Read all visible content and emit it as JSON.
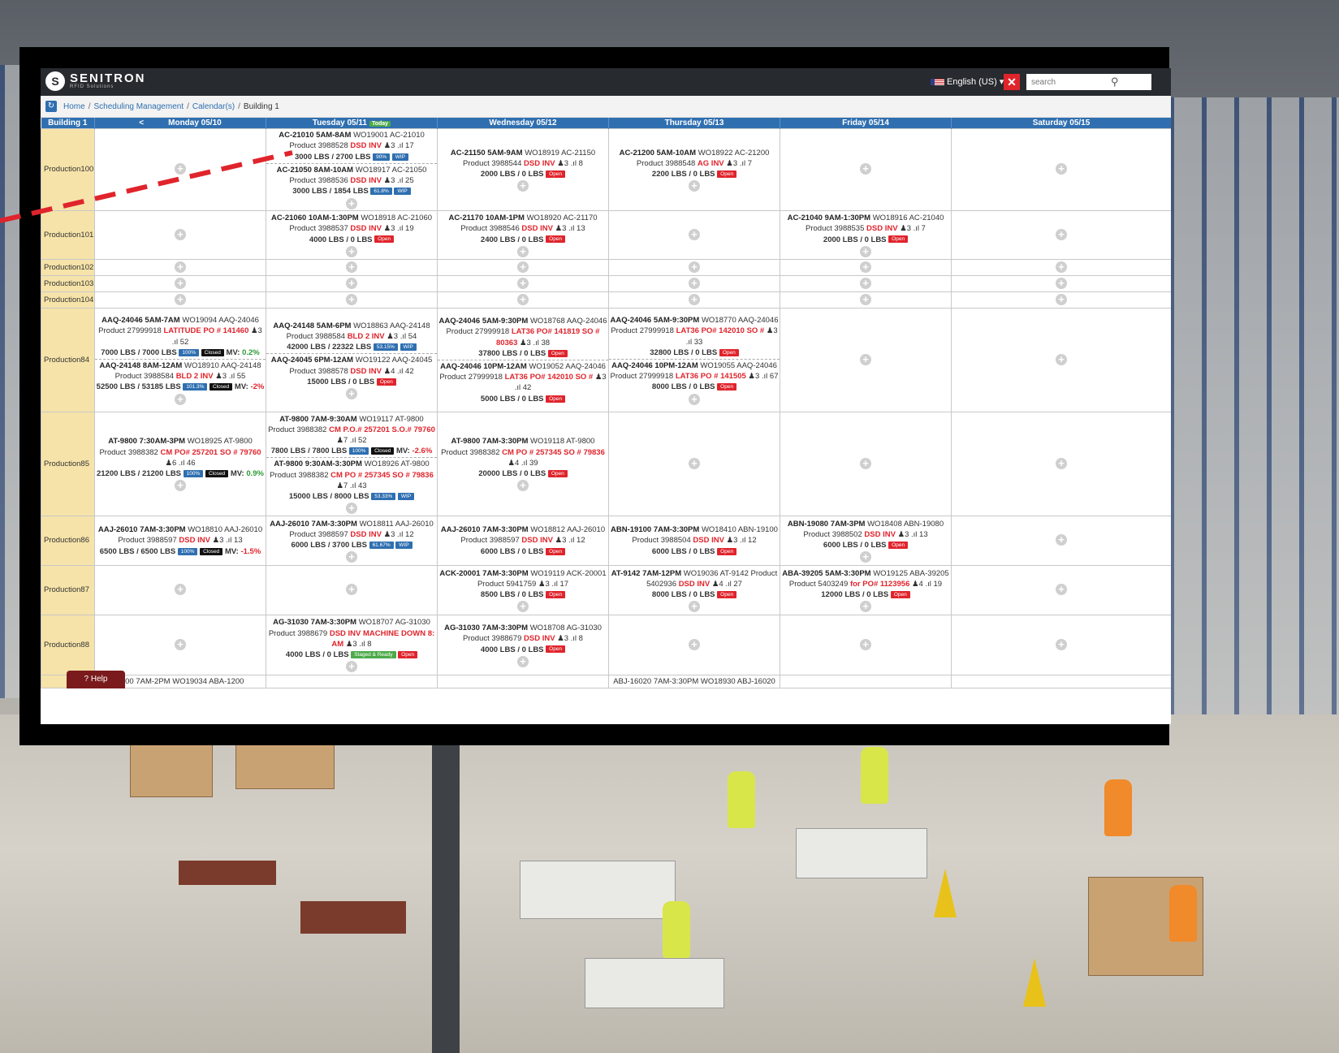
{
  "app": {
    "brand": "SENITRON",
    "brand_sub": "RFID Solutions",
    "language": "English (US)",
    "search_placeholder": "search"
  },
  "breadcrumb": [
    "Home",
    "Scheduling Management",
    "Calendar(s)",
    "Building 1"
  ],
  "header": {
    "building": "Building 1",
    "prev": "<",
    "days": [
      "Monday 05/10",
      "Tuesday 05/11",
      "Wednesday 05/12",
      "Thursday 05/13",
      "Friday 05/14",
      "Saturday 05/15"
    ],
    "today_badge": "Today"
  },
  "rows": {
    "r100": "Production100",
    "r101": "Production101",
    "r102": "Production102",
    "r103": "Production103",
    "r104": "Production104",
    "r84": "Production84",
    "r85": "Production85",
    "r86": "Production86",
    "r87": "Production87",
    "r88": "Production88"
  },
  "jobs": {
    "r100_tue_1": {
      "line1": "AC-21010 5AM-8AM",
      "line1b": "WO19001 AC-21010",
      "prod": "Product 3988528",
      "tag": "DSD INV",
      "meta": "3 .ıl 17",
      "lbs": "3000 LBS / 2700 LBS",
      "b1": "90%",
      "b2": "WIP"
    },
    "r100_tue_2": {
      "line1": "AC-21050 8AM-10AM",
      "line1b": "WO18917 AC-21050",
      "prod": "Product 3988536",
      "tag": "DSD INV",
      "meta": "3 .ıl 25",
      "lbs": "3000 LBS / 1854 LBS",
      "b1": "61.8%",
      "b2": "WIP"
    },
    "r100_wed": {
      "line1": "AC-21150 5AM-9AM",
      "line1b": "WO18919 AC-21150",
      "prod": "Product 3988544",
      "tag": "DSD INV",
      "meta": "3 .ıl 8",
      "lbs": "2000 LBS / 0 LBS",
      "b2": "Open"
    },
    "r100_thu": {
      "line1": "AC-21200 5AM-10AM",
      "line1b": "WO18922 AC-21200",
      "prod": "Product 3988548",
      "tag": "AG INV",
      "meta": "3 .ıl 7",
      "lbs": "2200 LBS / 0 LBS",
      "b2": "Open"
    },
    "r101_tue": {
      "line1": "AC-21060 10AM-1:30PM",
      "line1b": "WO18918 AC-21060",
      "prod": "Product 3988537",
      "tag": "DSD INV",
      "meta": "3 .ıl 19",
      "lbs": "4000 LBS / 0 LBS",
      "b2": "Open"
    },
    "r101_wed": {
      "line1": "AC-21170 10AM-1PM",
      "line1b": "WO18920 AC-21170",
      "prod": "Product 3988546",
      "tag": "DSD INV",
      "meta": "3 .ıl 13",
      "lbs": "2400 LBS / 0 LBS",
      "b2": "Open"
    },
    "r101_fri": {
      "line1": "AC-21040 9AM-1:30PM",
      "line1b": "WO18916 AC-21040",
      "prod": "Product 3988535",
      "tag": "DSD INV",
      "meta": "3 .ıl 7",
      "lbs": "2000 LBS / 0 LBS",
      "b2": "Open"
    },
    "r84_mon_1": {
      "line1": "AAQ-24046 5AM-7AM",
      "line1b": "WO19094 AAQ-24046",
      "prod": "Product 27999918",
      "tag": "LATITUDE PO # 141460",
      "meta": "3 .ıl 52",
      "lbs": "7000 LBS / 7000 LBS",
      "b1": "100%",
      "b2": "Closed",
      "mv": "MV: ",
      "mvv": "0.2%"
    },
    "r84_mon_2": {
      "line1": "AAQ-24148 8AM-12AM",
      "line1b": "WO18910 AAQ-24148",
      "prod": "Product 3988584",
      "tag": "BLD 2 INV",
      "meta": "3 .ıl 55",
      "lbs": "52500 LBS / 53185 LBS",
      "b1": "101.3%",
      "b2": "Closed",
      "mv": "MV: ",
      "mvv": "-2%"
    },
    "r84_tue_1": {
      "line1": "AAQ-24148 5AM-6PM",
      "line1b": "WO18863 AAQ-24148",
      "prod": "Product 3988584",
      "tag": "BLD 2 INV",
      "meta": "3 .ıl 54",
      "lbs": "42000 LBS / 22322 LBS",
      "b1": "53.15%",
      "b2": "WIP"
    },
    "r84_tue_2": {
      "line1": "AAQ-24045 6PM-12AM",
      "line1b": "WO19122 AAQ-24045",
      "prod": "Product 3988578",
      "tag": "DSD INV",
      "meta": "4 .ıl 42",
      "lbs": "15000 LBS / 0 LBS",
      "b2": "Open"
    },
    "r84_wed_1": {
      "line1": "AAQ-24046 5AM-9:30PM",
      "line1b": "WO18768 AAQ-24046",
      "prod": "Product 27999918",
      "tag": "LAT36 PO# 141819 SO # 80363",
      "meta": "3 .ıl 38",
      "lbs": "37800 LBS / 0 LBS",
      "b2": "Open"
    },
    "r84_wed_2": {
      "line1": "AAQ-24046 10PM-12AM",
      "line1b": "WO19052 AAQ-24046",
      "prod": "Product 27999918",
      "tag": "LAT36 PO# 142010 SO #",
      "meta": "3 .ıl 42",
      "lbs": "5000 LBS / 0 LBS",
      "b2": "Open"
    },
    "r84_thu_1": {
      "line1": "AAQ-24046 5AM-9:30PM",
      "line1b": "WO18770 AAQ-24046",
      "prod": "Product 27999918",
      "tag": "LAT36 PO# 142010 SO #",
      "meta": "3 .ıl 33",
      "lbs": "32800 LBS / 0 LBS",
      "b2": "Open"
    },
    "r84_thu_2": {
      "line1": "AAQ-24046 10PM-12AM",
      "line1b": "WO19055 AAQ-24046",
      "prod": "Product 27999918",
      "tag": "LAT36 PO # 141505",
      "meta": "3 .ıl 67",
      "lbs": "8000 LBS / 0 LBS",
      "b2": "Open"
    },
    "r85_mon": {
      "line1": "AT-9800 7:30AM-3PM",
      "line1b": "WO18925 AT-9800 Product 3988382",
      "tag": "CM PO# 257201 SO # 79760",
      "meta": "6 .ıl 46",
      "lbs": "21200 LBS / 21200 LBS",
      "b1": "100%",
      "b2": "Closed",
      "mv": "MV: ",
      "mvv": "0.9%"
    },
    "r85_tue_1": {
      "line1": "AT-9800 7AM-9:30AM",
      "line1b": "WO19117 AT-9800 Product 3988382",
      "tag": "CM P.O.# 257201 S.O.# 79760",
      "meta": "7 .ıl 52",
      "lbs": "7800 LBS / 7800 LBS",
      "b1": "100%",
      "b2": "Closed",
      "mv": "MV: ",
      "mvv": "-2.6%"
    },
    "r85_tue_2": {
      "line1": "AT-9800 9:30AM-3:30PM",
      "line1b": "WO18926 AT-9800 Product 3988382",
      "tag": "CM PO # 257345 SO # 79836",
      "meta": "7 .ıl 43",
      "lbs": "15000 LBS / 8000 LBS",
      "b1": "53.33%",
      "b2": "WIP"
    },
    "r85_wed": {
      "line1": "AT-9800 7AM-3:30PM",
      "line1b": "WO19118 AT-9800 Product 3988382",
      "tag": "CM PO # 257345 SO # 79836",
      "meta": "4 .ıl 39",
      "lbs": "20000 LBS / 0 LBS",
      "b2": "Open"
    },
    "r86_mon": {
      "line1": "AAJ-26010 7AM-3:30PM",
      "line1b": "WO18810 AAJ-26010",
      "prod": "Product 3988597",
      "tag": "DSD INV",
      "meta": "3 .ıl 13",
      "lbs": "6500 LBS / 6500 LBS",
      "b1": "100%",
      "b2": "Closed",
      "mv": "MV: ",
      "mvv": "-1.5%"
    },
    "r86_tue": {
      "line1": "AAJ-26010 7AM-3:30PM",
      "line1b": "WO18811 AAJ-26010",
      "prod": "Product 3988597",
      "tag": "DSD INV",
      "meta": "3 .ıl 12",
      "lbs": "6000 LBS / 3700 LBS",
      "b1": "61.67%",
      "b2": "WIP"
    },
    "r86_wed": {
      "line1": "AAJ-26010 7AM-3:30PM",
      "line1b": "WO18812 AAJ-26010",
      "prod": "Product 3988597",
      "tag": "DSD INV",
      "meta": "3 .ıl 12",
      "lbs": "6000 LBS / 0 LBS",
      "b2": "Open"
    },
    "r86_thu": {
      "line1": "ABN-19100 7AM-3:30PM",
      "line1b": "WO18410 ABN-19100",
      "prod": "Product 3988504",
      "tag": "DSD INV",
      "meta": "3 .ıl 12",
      "lbs": "6000 LBS / 0 LBS",
      "b2": "Open"
    },
    "r86_fri": {
      "line1": "ABN-19080 7AM-3PM",
      "line1b": "WO18408 ABN-19080",
      "prod": "Product 3988502",
      "tag": "DSD INV",
      "meta": "3 .ıl 13",
      "lbs": "6000 LBS / 0 LBS",
      "b2": "Open"
    },
    "r87_wed": {
      "line1": "ACK-20001 7AM-3:30PM",
      "line1b": "WO19119 ACK-20001",
      "prod": "Product 5941759",
      "tag": "",
      "meta": "3 .ıl 17",
      "lbs": "8500 LBS / 0 LBS",
      "b2": "Open"
    },
    "r87_thu": {
      "line1": "AT-9142 7AM-12PM",
      "line1b": "WO19036 AT-9142 Product 5402936",
      "tag": "DSD INV",
      "meta": "4 .ıl 27",
      "lbs": "8000 LBS / 0 LBS",
      "b2": "Open"
    },
    "r87_fri": {
      "line1": "ABA-39205 5AM-3:30PM",
      "line1b": "WO19125 ABA-39205",
      "prod": "Product 5403249",
      "tag": "for PO# 1123956",
      "meta": "4 .ıl 19",
      "lbs": "12000 LBS / 0 LBS",
      "b2": "Open"
    },
    "r88_tue": {
      "line1": "AG-31030 7AM-3:30PM",
      "line1b": "WO18707 AG-31030",
      "prod": "Product 3988679",
      "tag": "DSD INV MACHINE DOWN 8: AM",
      "meta": "3 .ıl 8",
      "lbs": "4000 LBS / 0 LBS",
      "b1": "Staged & Ready",
      "b2": "Open"
    },
    "r88_wed": {
      "line1": "AG-31030 7AM-3:30PM",
      "line1b": "WO18708 AG-31030",
      "prod": "Product 3988679",
      "tag": "DSD INV",
      "meta": "3 .ıl 8",
      "lbs": "4000 LBS / 0 LBS",
      "b2": "Open"
    }
  },
  "partial_row": {
    "mon": "1200 7AM-2PM WO19034 ABA-1200",
    "thu": "ABJ-16020 7AM-3:30PM WO18930 ABJ-16020"
  },
  "help_label": "Help"
}
